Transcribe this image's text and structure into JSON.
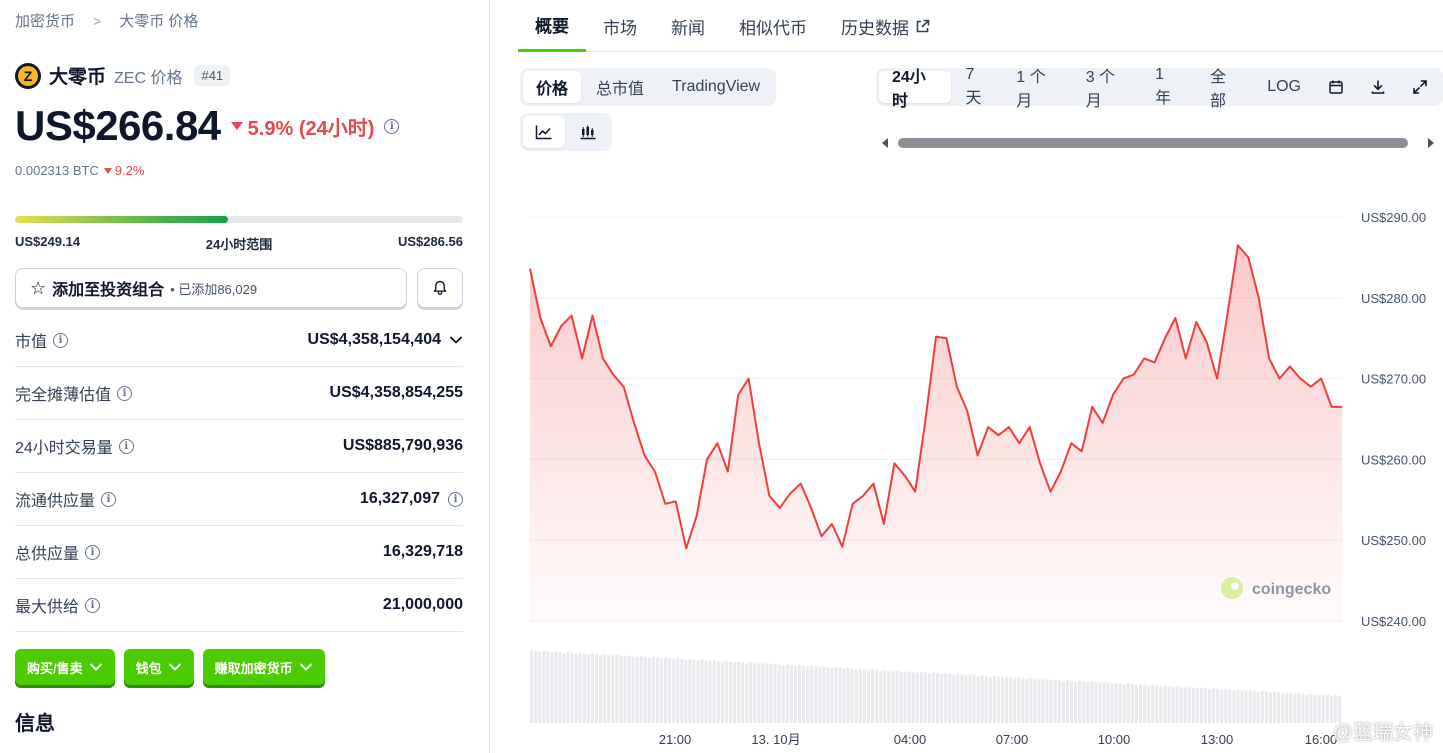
{
  "breadcrumb": {
    "root": "加密货币",
    "current": "大零币 价格"
  },
  "coin": {
    "name": "大零币",
    "symbol_label": "ZEC 价格",
    "rank": "#41",
    "logo_letter": "Z"
  },
  "price": {
    "value": "US$266.84",
    "change": "5.9% (24小时)",
    "btc_value": "0.002313 BTC",
    "btc_change": "9.2%"
  },
  "range": {
    "low": "US$249.14",
    "label": "24小时范围",
    "high": "US$286.56",
    "fill_fraction": 0.475
  },
  "portfolio": {
    "label": "添加至投资组合",
    "count_text": "• 已添加86,029"
  },
  "stats": [
    {
      "label": "市值",
      "value": "US$4,358,154,404"
    },
    {
      "label": "完全摊薄估值",
      "value": "US$4,358,854,255"
    },
    {
      "label": "24小时交易量",
      "value": "US$885,790,936"
    },
    {
      "label": "流通供应量",
      "value": "16,327,097"
    },
    {
      "label": "总供应量",
      "value": "16,329,718"
    },
    {
      "label": "最大供给",
      "value": "21,000,000"
    }
  ],
  "actions": [
    "购买/售卖",
    "钱包",
    "赚取加密货币"
  ],
  "info_title": "信息",
  "tabs": [
    "概要",
    "市场",
    "新闻",
    "相似代币",
    "历史数据"
  ],
  "chart_controls": {
    "metric": [
      "价格",
      "总市值",
      "TradingView"
    ],
    "ranges": [
      "24小时",
      "7天",
      "1 个月",
      "3 个月",
      "1 年",
      "全部",
      "LOG"
    ]
  },
  "brand": "coingecko",
  "watermark": "@蓝瑞女神",
  "colors": {
    "accent": "#4bcc00",
    "negative": "#e5484d",
    "line": "#f23d3d"
  },
  "chart_data": {
    "type": "area",
    "title": "",
    "xlabel": "",
    "ylabel": "",
    "ylim": [
      240,
      290
    ],
    "xlim": [
      18.3,
      16.5
    ],
    "y_ticks": [
      "US$290.00",
      "US$280.00",
      "US$270.00",
      "US$260.00",
      "US$250.00",
      "US$240.00"
    ],
    "x_ticks": [
      "21:00",
      "13. 10月",
      "04:00",
      "07:00",
      "10:00",
      "13:00",
      "16:00"
    ],
    "series": [
      {
        "values": [
          283.6,
          277.5,
          274.0,
          276.5,
          277.8,
          272.5,
          277.8,
          272.5,
          270.5,
          269.0,
          264.5,
          260.5,
          258.5,
          254.5,
          254.8,
          249.0,
          253.0,
          260.0,
          262.0,
          258.5,
          268.0,
          270.0,
          262.0,
          255.5,
          254.0,
          255.8,
          257.0,
          254.0,
          250.5,
          252.0,
          249.2,
          254.5,
          255.5,
          257.0,
          252.0,
          259.5,
          258.0,
          256.0,
          265.0,
          275.2,
          275.0,
          269.0,
          266.0,
          260.5,
          264.0,
          263.0,
          264.0,
          262.0,
          264.0,
          259.5,
          256.0,
          258.5,
          262.0,
          261.0,
          266.5,
          264.5,
          268.0,
          270.0,
          270.5,
          272.5,
          272.0,
          275.0,
          277.5,
          272.5,
          277.0,
          274.5,
          270.0,
          278.0,
          286.5,
          285.0,
          280.0,
          272.5,
          270.0,
          271.5,
          270.0,
          269.0,
          270.0,
          266.5,
          266.5
        ]
      }
    ],
    "volume": "decreasing bars across the period"
  }
}
